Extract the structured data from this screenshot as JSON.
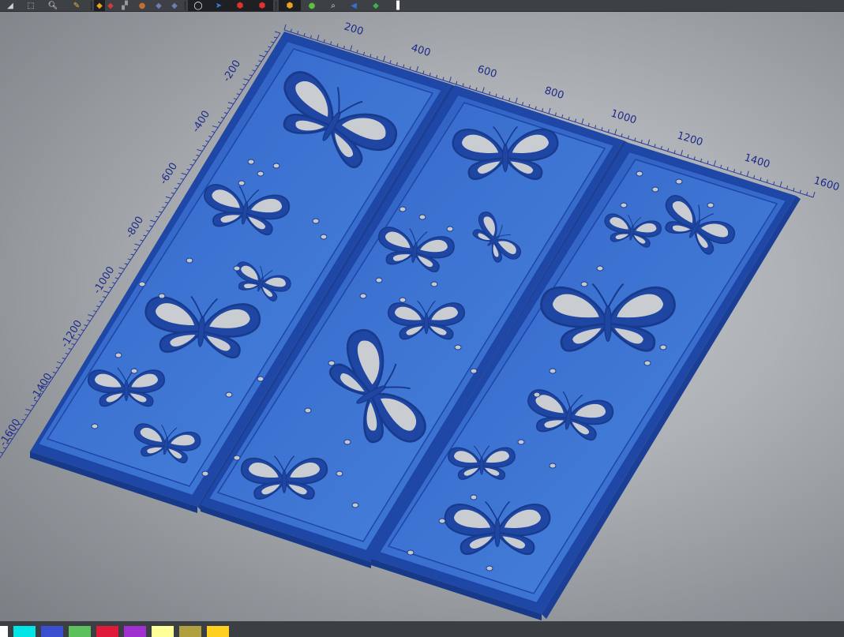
{
  "toolbar": {
    "tools": [
      {
        "name": "view-cube-icon",
        "glyph": "◢",
        "color": "#cfd2d6"
      },
      {
        "name": "box-view-icon",
        "glyph": "⬚",
        "color": "#cfd2d6"
      },
      {
        "name": "zoom-icon",
        "glyph": "🔍︎",
        "color": "#ffffff"
      },
      {
        "name": "pencil-icon",
        "glyph": "✎",
        "color": "#e8b23a"
      },
      {
        "name": "layer-yellow-icon",
        "glyph": "◆",
        "color": "#e8a21c"
      },
      {
        "name": "layer-red-icon",
        "glyph": "◆",
        "color": "#d23a3a"
      },
      {
        "name": "mesh-icon",
        "glyph": "▞",
        "color": "#9a9a9a"
      },
      {
        "name": "blob-icon",
        "glyph": "●",
        "color": "#c07030"
      },
      {
        "name": "shape-blue-icon",
        "glyph": "◆",
        "color": "#6f7db0"
      },
      {
        "name": "shape-blue2-icon",
        "glyph": "◆",
        "color": "#6f7db0"
      },
      {
        "name": "circle-outline-icon",
        "glyph": "◯",
        "color": "#ffffff"
      },
      {
        "name": "arrow-blue-icon",
        "glyph": "➤",
        "color": "#3a7de0"
      },
      {
        "name": "cube-red-icon",
        "glyph": "⬢",
        "color": "#e03030"
      },
      {
        "name": "cube-red2-icon",
        "glyph": "⬢",
        "color": "#e03030"
      },
      {
        "name": "cube-orange-icon",
        "glyph": "⬢",
        "color": "#f0a020"
      },
      {
        "name": "green-dot-icon",
        "glyph": "●",
        "color": "#5fc040"
      },
      {
        "name": "search-icon",
        "glyph": "⌕",
        "color": "#e0e0e0"
      },
      {
        "name": "arrow-left-icon",
        "glyph": "◀",
        "color": "#3a6fd0"
      },
      {
        "name": "green-diamond-icon",
        "glyph": "◆",
        "color": "#3fb050"
      },
      {
        "name": "cursor-icon",
        "glyph": "▌",
        "color": "#ffffff"
      }
    ]
  },
  "ruler_top": {
    "labels": [
      "200",
      "400",
      "600",
      "800",
      "1000",
      "1200",
      "1400",
      "1600"
    ]
  },
  "ruler_left": {
    "labels": [
      "-200",
      "-400",
      "-600",
      "-800",
      "-1000",
      "-1200",
      "-1400",
      "-1600"
    ]
  },
  "panels": {
    "color": "#2f5fc4",
    "count": 3
  },
  "palette": {
    "colors": [
      "#ffffff",
      "#00e5e5",
      "#3a4fd0",
      "#5cc05c",
      "#e01a3a",
      "#a030d0",
      "#ffff99",
      "#b0a040",
      "#ffd020"
    ]
  }
}
